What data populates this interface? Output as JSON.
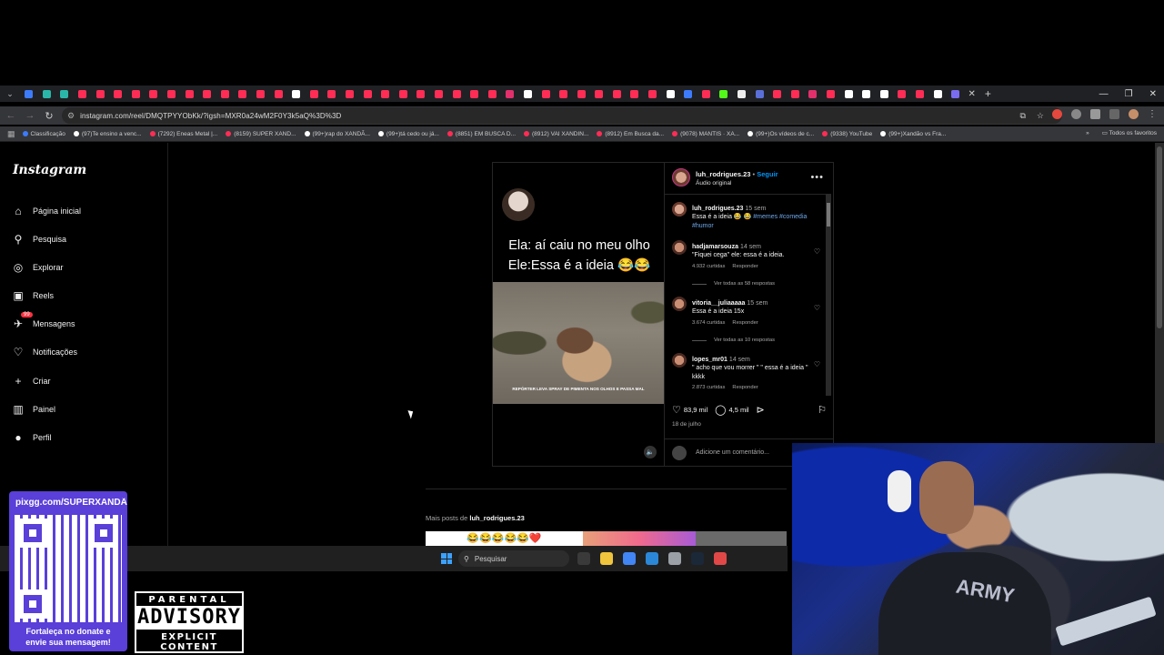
{
  "browser": {
    "tab_favicon_colors": [
      "#3d7bfd",
      "#2ab7a9",
      "#2ab7a9",
      "#ff2d55",
      "#ff2d55",
      "#ff2d55",
      "#ff2d55",
      "#ff2d55",
      "#ff2d55",
      "#ff2d55",
      "#ff2d55",
      "#ff2d55",
      "#ff2d55",
      "#ff2d55",
      "#ff2d55",
      "#ffffff",
      "#ff2d55",
      "#ff2d55",
      "#ff2d55",
      "#ff2d55",
      "#ff2d55",
      "#ff2d55",
      "#ff2d55",
      "#ff2d55",
      "#ff2d55",
      "#ff2d55",
      "#ff2d55",
      "#e1306c",
      "#ffffff",
      "#ff2d55",
      "#ff2d55",
      "#ff2d55",
      "#ff2d55",
      "#ff2d55",
      "#ff2d55",
      "#ff2d55",
      "#ffffff",
      "#3d7bfd",
      "#ff2d55",
      "#53fc18",
      "#eeeeee",
      "#5a6fd8",
      "#ff2d55",
      "#ff2d55",
      "#e1306c",
      "#ff2d55",
      "#ffffff",
      "#ffffff",
      "#ffffff",
      "#ff2d55",
      "#ff2d55",
      "#ffffff",
      "#7a6cf0"
    ],
    "url": "instagram.com/reel/DMQTPYYObKk/?igsh=MXR0a24wM2F0Y3k5aQ%3D%3D",
    "bookmarks": [
      {
        "label": "Classificação",
        "color": "#3d7bfd"
      },
      {
        "label": "(97)Te ensino a venc...",
        "color": "#ffffff"
      },
      {
        "label": "(7292) Eneas Metal |...",
        "color": "#ff2d55"
      },
      {
        "label": "(8159) SUPER XAND...",
        "color": "#ff2d55"
      },
      {
        "label": "(99+)rap do XANDÃ...",
        "color": "#ffffff"
      },
      {
        "label": "(99+)tá cedo ou já...",
        "color": "#ffffff"
      },
      {
        "label": "(8851) EM BUSCA D...",
        "color": "#ff2d55"
      },
      {
        "label": "(8912) VAI XANDIN...",
        "color": "#ff2d55"
      },
      {
        "label": "(8912) Em Busca da...",
        "color": "#ff2d55"
      },
      {
        "label": "(9078) MANTIS · XA...",
        "color": "#ff2d55"
      },
      {
        "label": "(99+)Os vídeos de c...",
        "color": "#ffffff"
      },
      {
        "label": "(9338) YouTube",
        "color": "#ff2d55"
      },
      {
        "label": "(99+)Xandão vs Fra...",
        "color": "#ffffff"
      }
    ],
    "all_bookmarks": "Todos os favoritos"
  },
  "instagram": {
    "logo": "Instagram",
    "nav": [
      {
        "label": "Página inicial",
        "icon": "home-icon",
        "glyph": "⌂"
      },
      {
        "label": "Pesquisa",
        "icon": "search-icon",
        "glyph": "⚲"
      },
      {
        "label": "Explorar",
        "icon": "compass-icon",
        "glyph": "◎"
      },
      {
        "label": "Reels",
        "icon": "reels-icon",
        "glyph": "▣"
      },
      {
        "label": "Mensagens",
        "icon": "messenger-icon",
        "glyph": "✈"
      },
      {
        "label": "Notificações",
        "icon": "heart-icon",
        "glyph": "♡"
      },
      {
        "label": "Criar",
        "icon": "plus-icon",
        "glyph": "+"
      },
      {
        "label": "Painel",
        "icon": "dashboard-icon",
        "glyph": "▥"
      },
      {
        "label": "Perfil",
        "icon": "profile-icon",
        "glyph": "●"
      }
    ],
    "messages_badge": "99",
    "video": {
      "caption_line1": "Ela: aí caiu no meu olho",
      "caption_line2": "Ele:Essa é a ideia 😂😂",
      "subtitle": "REPÓRTER LEVA SPRAY DE PIMENTA NOS OLHOS E PASSA MAL"
    },
    "post": {
      "username": "luh_rodrigues.23",
      "follow": "Seguir",
      "separator": " • ",
      "audio": "Áudio original",
      "caption_time": "15 sem",
      "caption_text": "Essa é a ideia 😂 😂",
      "caption_tags": "#memes #comedia #humor",
      "likes": "83,9 mil",
      "comments_count": "4,5 mil",
      "date": "18 de julho",
      "add_comment_placeholder": "Adicione um comentário..."
    },
    "comments": [
      {
        "user": "hadjamarsouza",
        "time": "14 sem",
        "text": "\"Fiquei cega\" ele: essa é a ideia.",
        "likes": "4.932 curtidas",
        "reply": "Responder",
        "replies": "Ver todas as 58 respostas"
      },
      {
        "user": "vitoria__juliaaaaa",
        "time": "15 sem",
        "text": "Essa é a ideia 15x",
        "likes": "3.674 curtidas",
        "reply": "Responder",
        "replies": "Ver todas as 10 respostas"
      },
      {
        "user": "lopes_mr01",
        "time": "14 sem",
        "text": "\" acho que vou morrer \" \" essa é a ideia \" kkkk",
        "likes": "2.873 curtidas",
        "reply": "Responder",
        "replies": ""
      }
    ],
    "more_posts_prefix": "Mais posts de ",
    "more_posts_user": "luh_rodrigues.23",
    "thumb1_text": "😂😂😂😂😂❤️"
  },
  "taskbar": {
    "search": "Pesquisar",
    "app_colors": [
      "#3a3a3a",
      "#f0c43c",
      "#4285f4",
      "#2b88d8",
      "#9aa0a6",
      "#1b2838",
      "#e04848"
    ]
  },
  "overlay": {
    "qr_title": "pixgg.com/SUPERXANDÃO",
    "qr_bottom_line1": "Fortaleça no donate e",
    "qr_bottom_line2": "envie sua mensagem!",
    "advisory_line1": "PARENTAL",
    "advisory_line2": "ADVISORY",
    "advisory_line3": "EXPLICIT CONTENT",
    "webcam_shirt": "ARMY"
  }
}
